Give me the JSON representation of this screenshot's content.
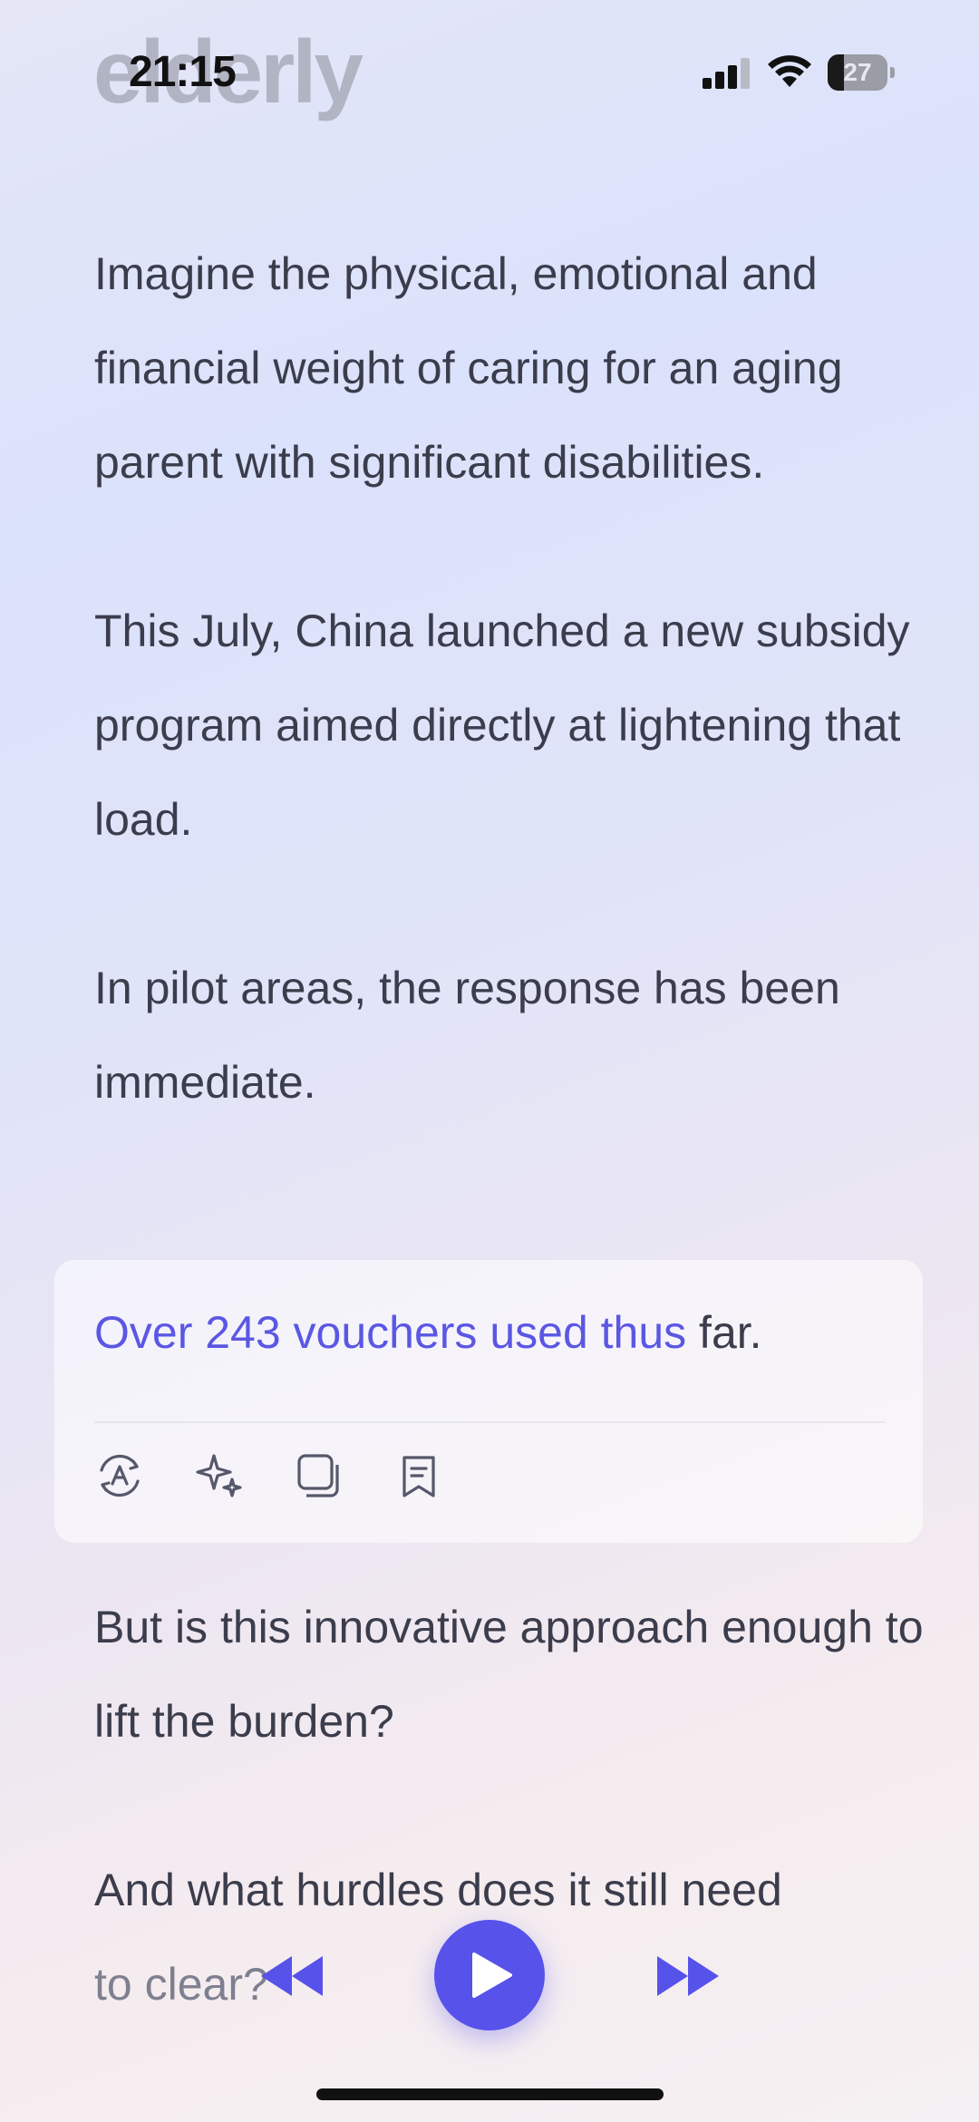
{
  "status_bar": {
    "time": "21:15",
    "battery_level": "27",
    "battery_fraction": 0.27
  },
  "header": {
    "faded_title": "elderly"
  },
  "article": {
    "paragraphs_top": [
      "Imagine the physical, emotional and financial weight of caring for an aging parent with significant disabilities.",
      "This July, China launched a new subsidy program aimed directly at lightening that load.",
      "In pilot areas, the response has been immediate."
    ],
    "highlight": {
      "highlighted_text": "Over 243 vouchers used thus",
      "rest_text": " far."
    },
    "paragraphs_bottom": [
      "But is this innovative approach enough to lift the burden?"
    ],
    "last_paragraph": {
      "line1": "And what hurdles does it still need",
      "line2": "to clear?"
    }
  },
  "card_actions": [
    {
      "icon": "translate-icon"
    },
    {
      "icon": "sparkle-icon"
    },
    {
      "icon": "copy-icon"
    },
    {
      "icon": "bookmark-icon"
    }
  ],
  "player": {
    "rewind_icon": "rewind-icon",
    "play_icon": "play-icon",
    "forward_icon": "fast-forward-icon"
  },
  "colors": {
    "accent": "#5752ea",
    "highlight_text": "#5b57e4",
    "body_text": "#3b3d4c"
  }
}
